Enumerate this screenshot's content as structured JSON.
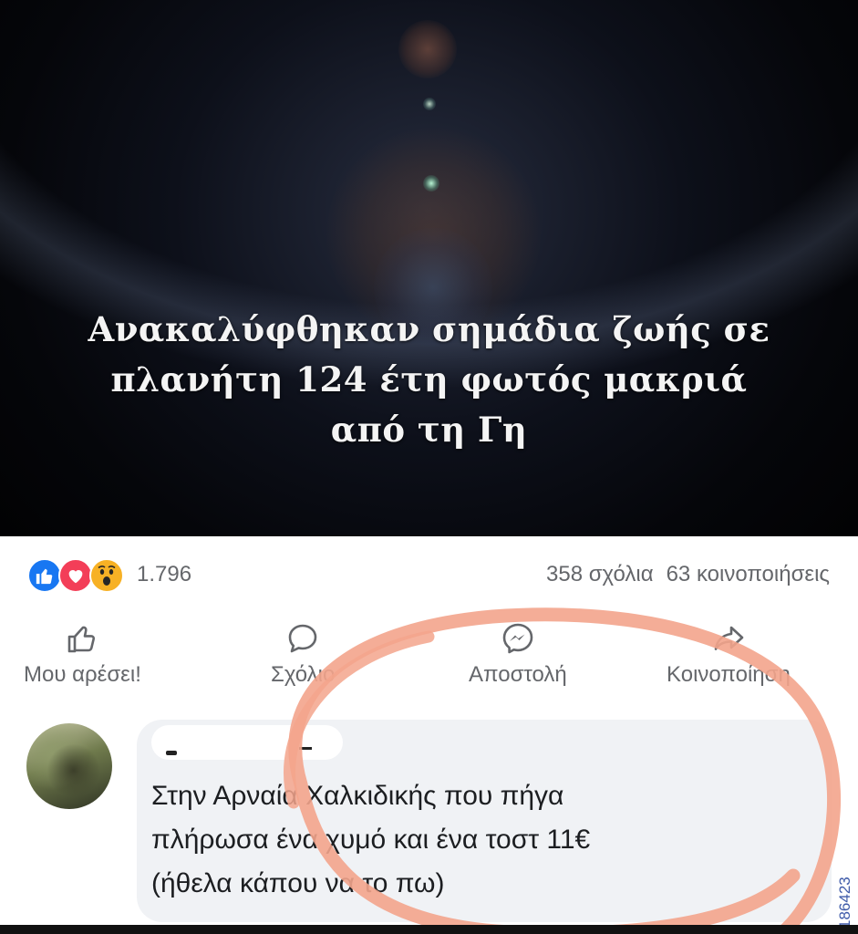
{
  "post": {
    "image_caption_lines": [
      "Ανακαλύφθηκαν σημάδια ζωής σε",
      "πλανήτη 124 έτη φωτός μακριά",
      "από τη Γη"
    ]
  },
  "summary": {
    "reaction_count": "1.796",
    "comments": "358 σχόλια",
    "shares": "63 κοινοποιήσεις",
    "reaction_icons": [
      "like-icon",
      "love-icon",
      "wow-icon"
    ]
  },
  "actions": {
    "like": "Μου αρέσει!",
    "comment": "Σχόλιο",
    "send": "Αποστολή",
    "share": "Κοινοποίηση"
  },
  "comment": {
    "text_lines": [
      "Στην Αρναία Χαλκιδικής που πήγα",
      "πλήρωσα ένα χυμό και ένα τοστ 11€",
      "(ήθελα κάπου να το πω)"
    ]
  },
  "watermark": "186423",
  "colors": {
    "brand_blue": "#1877f2",
    "love_red": "#f33e58",
    "wow_yellow": "#f7b125",
    "highlight": "#f3a48c",
    "muted_text": "#65676b"
  }
}
